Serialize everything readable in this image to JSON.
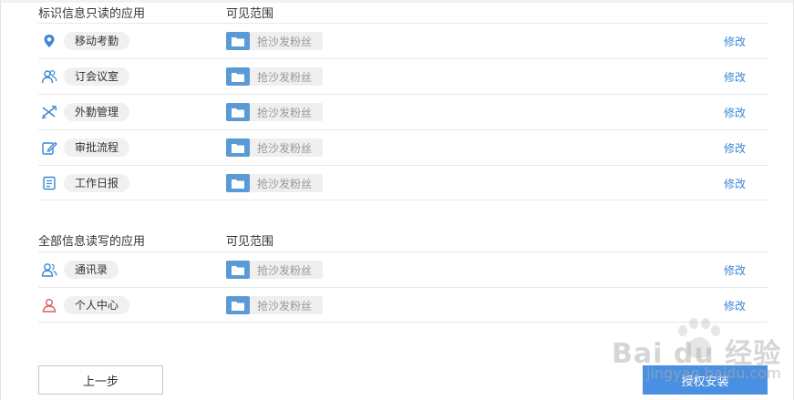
{
  "section_readonly": {
    "title": "标识信息只读的应用",
    "scope_header": "可见范围",
    "rows": [
      {
        "name": "移动考勤",
        "icon": "location-pin-icon",
        "scope": "抢沙发粉丝",
        "action": "修改"
      },
      {
        "name": "订会议室",
        "icon": "meeting-people-icon",
        "scope": "抢沙发粉丝",
        "action": "修改"
      },
      {
        "name": "外勤管理",
        "icon": "airplane-icon",
        "scope": "抢沙发粉丝",
        "action": "修改"
      },
      {
        "name": "审批流程",
        "icon": "edit-pen-icon",
        "scope": "抢沙发粉丝",
        "action": "修改"
      },
      {
        "name": "工作日报",
        "icon": "document-list-icon",
        "scope": "抢沙发粉丝",
        "action": "修改"
      }
    ]
  },
  "section_readwrite": {
    "title": "全部信息读写的应用",
    "scope_header": "可见范围",
    "rows": [
      {
        "name": "通讯录",
        "icon": "contacts-icon",
        "scope": "抢沙发粉丝",
        "action": "修改"
      },
      {
        "name": "个人中心",
        "icon": "person-icon",
        "scope": "抢沙发粉丝",
        "action": "修改"
      }
    ]
  },
  "footer": {
    "prev_label": "上一步",
    "install_label": "授权安装"
  },
  "watermark": {
    "brand": "Bai du 经验",
    "url": "jingyan.baidu.com"
  },
  "colors": {
    "accent": "#4a90e2",
    "link": "#3a87d6",
    "icon_blue": "#3a87d6",
    "icon_red": "#e05a5a",
    "folder": "#5b9bd5"
  }
}
